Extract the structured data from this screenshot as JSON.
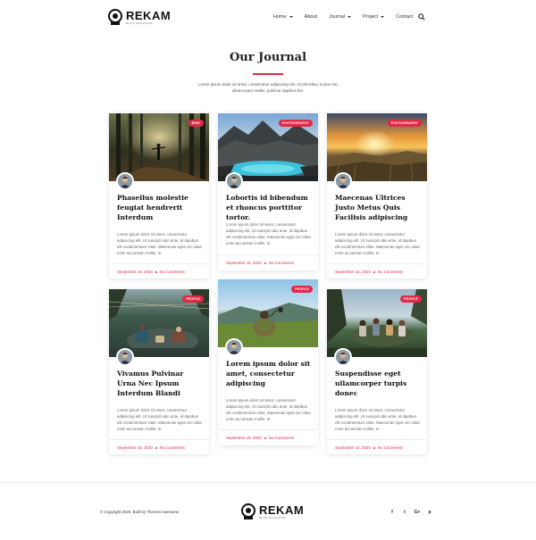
{
  "brand": {
    "name": "REKAM",
    "tagline": "BLOG MAGAZINE"
  },
  "nav": {
    "items": [
      {
        "label": "Home",
        "has_caret": true
      },
      {
        "label": "About",
        "has_caret": false
      },
      {
        "label": "Journal",
        "has_caret": true
      },
      {
        "label": "Project",
        "has_caret": true
      },
      {
        "label": "Contact",
        "has_caret": false
      }
    ],
    "search_icon": "search-icon"
  },
  "section": {
    "title": "Our Journal",
    "intro": "Lorem ipsum dolor sit amet, consectetur adipiscing elit. Ut elit tellus, luctus nec ullamcorper mattis, pulvinar dapibus leo."
  },
  "accent": "#e02a46",
  "posts": [
    {
      "badge": "BIKE",
      "title": "Phasellus molestie feugiat hendrerit Interdum",
      "excerpt": "Lorem ipsum dolor sit amet, consectetur adipiscing elit. Ut suscipit odio ante, id dapibus elit condimentum vitae. Maecenas eget orci vitae enim accumsan mollis. In",
      "date": "September 15, 2020",
      "comments": "No Comments"
    },
    {
      "badge": "PHOTOGRAPHY",
      "title": "Lobortis id bibendum et rhoncus porttitor tortor.",
      "excerpt": "Lorem ipsum dolor sit amet, consectetur adipiscing elit. Ut suscipit odio ante, id dapibus elit condimentum vitae. Maecenas eget orci vitae enim accumsan mollis. In",
      "date": "September 15, 2020",
      "comments": "No Comments"
    },
    {
      "badge": "PHOTOGRAPHY",
      "title": "Maecenas Ultrices Justo Metus Quis Facilisis adipiscing",
      "excerpt": "Lorem ipsum dolor sit amet, consectetur adipiscing elit. Ut suscipit odio ante, id dapibus elit condimentum vitae. Maecenas eget orci vitae enim accumsan mollis. In",
      "date": "September 15, 2020",
      "comments": "No Comments"
    },
    {
      "badge": "PEOPLE",
      "title": "Vivamus Pulvinar Urna Nec Ipsum Interdum Blandi",
      "excerpt": "Lorem ipsum dolor sit amet, consectetur adipiscing elit. Ut suscipit odio ante, id dapibus elit condimentum vitae. Maecenas eget orci vitae enim accumsan mollis. In",
      "date": "September 15, 2020",
      "comments": "No Comments"
    },
    {
      "badge": "PEOPLE",
      "title": "Lorem ipsum dolor sit amet, consectetur adipiscing",
      "excerpt": "Lorem ipsum dolor sit amet, consectetur adipiscing elit. Ut suscipit odio ante, id dapibus elit condimentum vitae. Maecenas eget orci vitae enim accumsan mollis. In",
      "date": "September 15, 2020",
      "comments": "No Comments"
    },
    {
      "badge": "PEOPLE",
      "title": "Suspendisse eget ullamcorper turpis donec",
      "excerpt": "Lorem ipsum dolor sit amet, consectetur adipiscing elit. Ut suscipit odio ante, id dapibus elit condimentum vitae. Maecenas eget orci vitae enim accumsan mollis. In",
      "date": "September 15, 2020",
      "comments": "No Comments"
    }
  ],
  "footer": {
    "copyright": "© Copyright 2020, Built by Themes Awesome",
    "socials": [
      {
        "icon": "facebook-icon",
        "glyph": "f"
      },
      {
        "icon": "twitter-icon",
        "glyph": "t"
      },
      {
        "icon": "google-plus-icon",
        "glyph": "G+"
      },
      {
        "icon": "pinterest-icon",
        "glyph": "p"
      }
    ]
  }
}
